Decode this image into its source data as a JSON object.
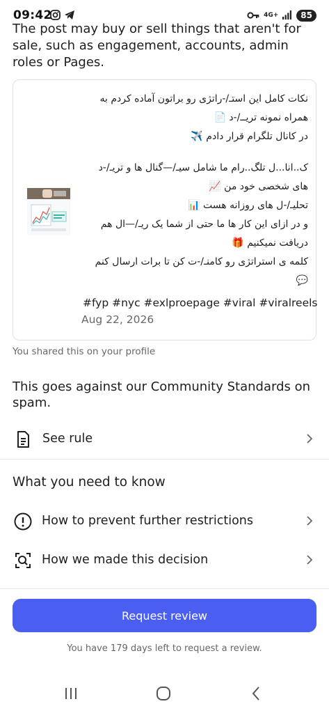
{
  "status_bar": {
    "time": "09:42",
    "network": "4G+",
    "battery": "85",
    "left_icons": [
      "instagram-icon",
      "telegram-icon"
    ],
    "right_icons": [
      "key-icon",
      "signal-icon"
    ]
  },
  "intro": {
    "text": "The post may buy or sell things that aren't for sale, such as engagement, accounts, admin roles or Pages."
  },
  "post": {
    "lines_group1": [
      "نکات کامل این استـ/-راتژی رو براتون آماده کردم به",
      "همراه نمونه تریــ/-د 📄",
      "در کانال تلگرام قرار دادم ✈️"
    ],
    "lines_group2": [
      "ک..انا...ل تلگ..رام ما شامل سیـ/—گنال ها و تریـ/-د",
      "های شخصی خود من 📈",
      "تحلیـ/-ل های روزانه هست 📊",
      "و در ازای این کار ها ما حتی از شما یک ریـ/—ال هم",
      "دریافت نمیکنیم 🎁",
      "کلمه ی استراتژی رو کامنـ/-ت کن تا برات ارسال کنم",
      "💬"
    ],
    "hashtags": "#fyp #nyc #exlproepage #viral #viralreels",
    "date": "Aug 22, 2026"
  },
  "shared_note": "You shared this on your profile",
  "standards_text": "This goes against our Community Standards on spam.",
  "see_rule": {
    "label": "See rule",
    "icon": "document-icon"
  },
  "section_title": "What you need to know",
  "info_items": [
    {
      "label": "How to prevent further restrictions",
      "icon": "alert-circle-icon"
    },
    {
      "label": "How we made this decision",
      "icon": "search-document-icon"
    }
  ],
  "request_review": {
    "label": "Request review",
    "color": "#4a5ef0"
  },
  "footnote": "You have 179 days left to request a review."
}
